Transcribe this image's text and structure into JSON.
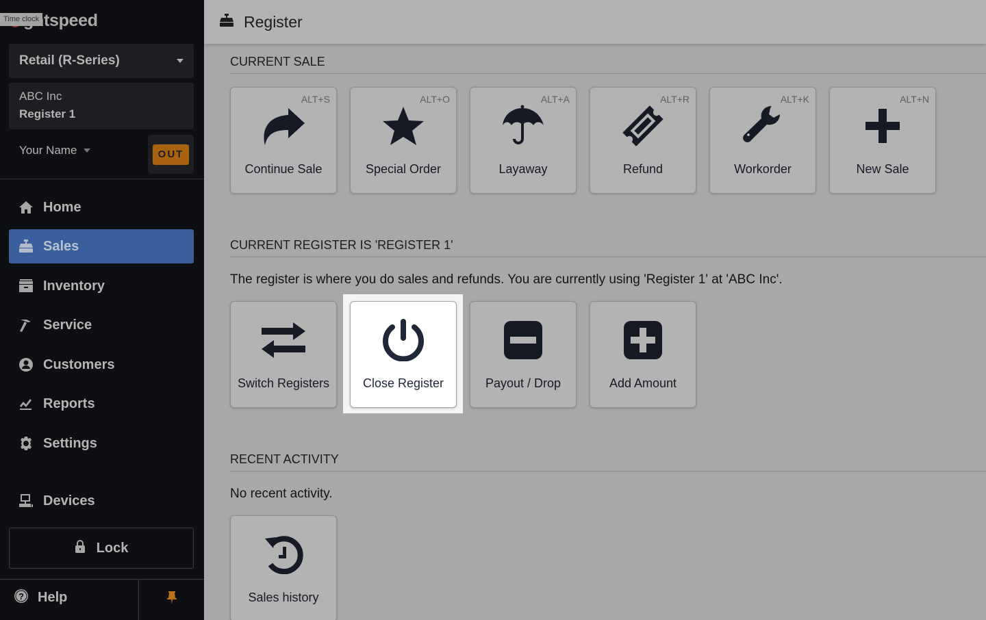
{
  "sidebar": {
    "logo_text": "ghtspeed",
    "tooltip": "Time clock",
    "store_selector": "Retail (R-Series)",
    "organization": "ABC Inc",
    "register": "Register 1",
    "user_name": "Your Name",
    "clock_button": "OUT",
    "nav": [
      {
        "label": "Home",
        "icon": "home-icon"
      },
      {
        "label": "Sales",
        "icon": "cash-register-icon",
        "active": true
      },
      {
        "label": "Inventory",
        "icon": "archive-icon"
      },
      {
        "label": "Service",
        "icon": "hammer-icon"
      },
      {
        "label": "Customers",
        "icon": "user-circle-icon"
      },
      {
        "label": "Reports",
        "icon": "chart-line-icon"
      },
      {
        "label": "Settings",
        "icon": "gear-icon"
      },
      {
        "label": "Devices",
        "icon": "devices-icon"
      }
    ],
    "lock_label": "Lock",
    "help_label": "Help"
  },
  "header": {
    "title": "Register"
  },
  "current_sale": {
    "title": "CURRENT SALE",
    "tiles": [
      {
        "label": "Continue Sale",
        "shortcut": "ALT+S",
        "icon": "share-arrow-icon"
      },
      {
        "label": "Special Order",
        "shortcut": "ALT+O",
        "icon": "star-icon"
      },
      {
        "label": "Layaway",
        "shortcut": "ALT+A",
        "icon": "umbrella-icon"
      },
      {
        "label": "Refund",
        "shortcut": "ALT+R",
        "icon": "ticket-icon"
      },
      {
        "label": "Workorder",
        "shortcut": "ALT+K",
        "icon": "wrench-icon"
      },
      {
        "label": "New Sale",
        "shortcut": "ALT+N",
        "icon": "plus-icon"
      }
    ]
  },
  "current_register": {
    "title": "CURRENT REGISTER IS 'REGISTER 1'",
    "description": "The register is where you do sales and refunds. You are currently using 'Register 1'  at 'ABC Inc'.",
    "tiles": [
      {
        "label": "Switch Registers",
        "icon": "exchange-icon"
      },
      {
        "label": "Close Register",
        "icon": "power-icon",
        "highlighted": true
      },
      {
        "label": "Payout / Drop",
        "icon": "minus-square-icon"
      },
      {
        "label": "Add Amount",
        "icon": "plus-square-icon"
      }
    ]
  },
  "recent_activity": {
    "title": "RECENT ACTIVITY",
    "empty_text": "No recent activity.",
    "tiles": [
      {
        "label": "Sales history",
        "icon": "history-icon"
      }
    ]
  },
  "colors": {
    "sidebar_bg": "#0e0f13",
    "active_nav": "#3a5f9c",
    "out_button": "#a9620f",
    "pin": "#b8701a",
    "logo_red": "#c4393a"
  }
}
